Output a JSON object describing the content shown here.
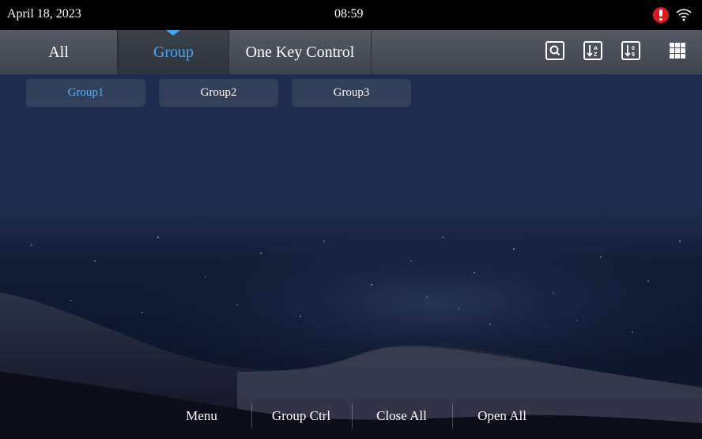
{
  "status": {
    "date": "April 18, 2023",
    "time": "08:59",
    "alert_icon": "alert-icon",
    "wifi_icon": "wifi-icon"
  },
  "tabs": [
    {
      "label": "All",
      "active": false
    },
    {
      "label": "Group",
      "active": true
    },
    {
      "label": "One Key Control",
      "active": false
    }
  ],
  "toolbar": {
    "icons": [
      "search-icon",
      "sort-alpha-icon",
      "sort-numeric-icon",
      "grid-icon"
    ]
  },
  "groups": [
    {
      "label": "Group1",
      "active": true
    },
    {
      "label": "Group2",
      "active": false
    },
    {
      "label": "Group3",
      "active": false
    }
  ],
  "bottom": {
    "menu": "Menu",
    "group_ctrl": "Group Ctrl",
    "close_all": "Close All",
    "open_all": "Open All"
  },
  "colors": {
    "accent": "#3fa9f5",
    "alert": "#e01818"
  }
}
